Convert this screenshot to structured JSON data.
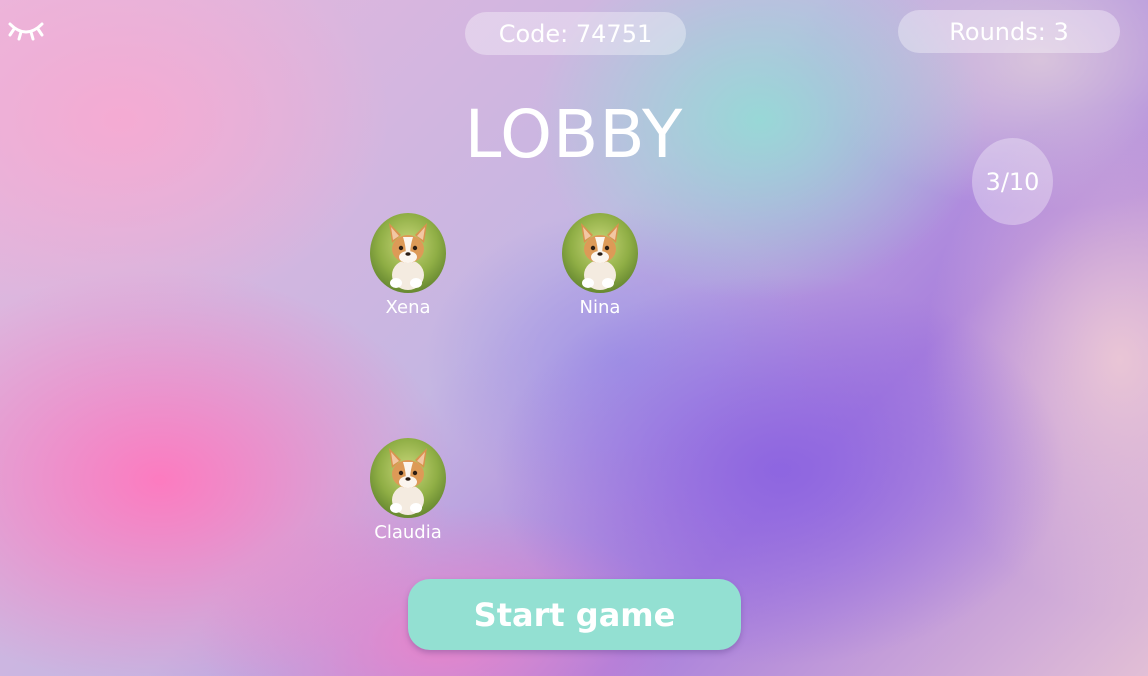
{
  "header": {
    "code_label": "Code: 74751",
    "rounds_label": "Rounds: 3",
    "visibility_icon": "closed-eye-icon"
  },
  "lobby": {
    "title": "LOBBY",
    "player_count": "3/10",
    "players": [
      {
        "name": "Xena",
        "avatar_icon": "corgi-puppy-avatar"
      },
      {
        "name": "Nina",
        "avatar_icon": "corgi-puppy-avatar"
      },
      {
        "name": "Claudia",
        "avatar_icon": "corgi-puppy-avatar"
      }
    ]
  },
  "actions": {
    "start_label": "Start game"
  },
  "colors": {
    "start_button": "#93e0d2",
    "text": "#ffffff"
  }
}
